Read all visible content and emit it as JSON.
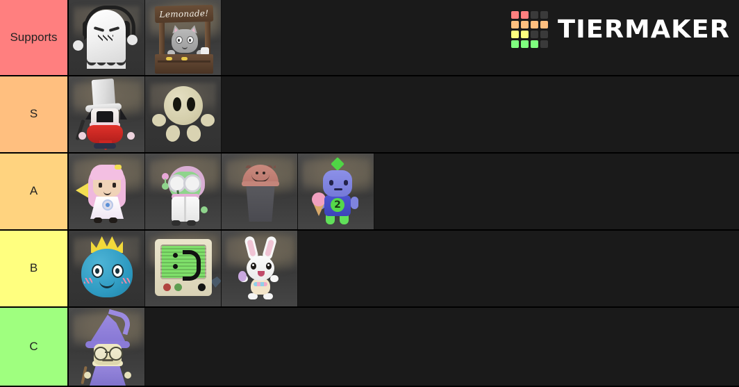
{
  "app": {
    "name": "TierMaker",
    "brand_wordmark": "TIERMAKER",
    "background_color": "#1a1a1a",
    "border_color": "#000000"
  },
  "brand_grid": {
    "rows": 4,
    "cols": 4,
    "cells": [
      [
        "#ff7f7f",
        "#ff7f7f",
        "#3a3a3a",
        "#3a3a3a"
      ],
      [
        "#ffbf7f",
        "#ffbf7f",
        "#ffbf7f",
        "#ffbf7f"
      ],
      [
        "#ffff7f",
        "#ffff7f",
        "#3a3a3a",
        "#3a3a3a"
      ],
      [
        "#7fff7f",
        "#7fff7f",
        "#7fff7f",
        "#3a3a3a"
      ]
    ]
  },
  "tiers": [
    {
      "label": "Supports",
      "color": "#ff7f7f",
      "items": [
        {
          "name": "ghost-with-headphones",
          "art": "ghost"
        },
        {
          "name": "lemonade-stand-cat",
          "art": "lemonade",
          "caption": "Lemonade!"
        }
      ]
    },
    {
      "label": "S",
      "color": "#ffbf7f",
      "items": [
        {
          "name": "top-hat-magician",
          "art": "magician"
        },
        {
          "name": "tan-blob-creature",
          "art": "tanblob"
        }
      ]
    },
    {
      "label": "A",
      "color": "#ffd37f",
      "items": [
        {
          "name": "pink-haired-girl",
          "art": "girl"
        },
        {
          "name": "green-scientist",
          "art": "scientist"
        },
        {
          "name": "trash-can-creature",
          "art": "trashcan"
        },
        {
          "name": "blue-ice-cream-kid",
          "art": "bluekid",
          "badge": "2"
        }
      ]
    },
    {
      "label": "B",
      "color": "#ffff7f",
      "items": [
        {
          "name": "blue-crowned-blob",
          "art": "blueblob"
        },
        {
          "name": "retro-computer",
          "art": "computer",
          "screen_face": ":D"
        },
        {
          "name": "easter-bunny",
          "art": "bunny"
        }
      ]
    },
    {
      "label": "C",
      "color": "#9fff7f",
      "items": [
        {
          "name": "purple-wizard",
          "art": "wizard"
        }
      ]
    }
  ]
}
